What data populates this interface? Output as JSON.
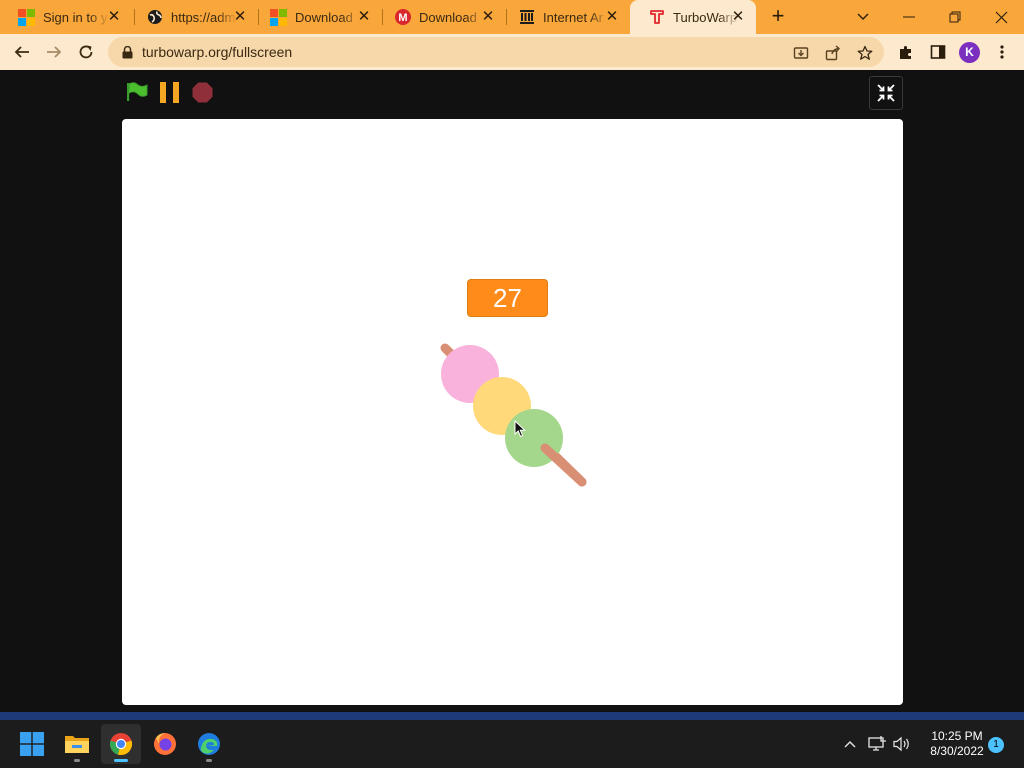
{
  "browser": {
    "tabs": [
      {
        "title": "Sign in to y",
        "icon": "microsoft-logo-icon"
      },
      {
        "title": "https://adm",
        "icon": "globe-icon"
      },
      {
        "title": "Download",
        "icon": "microsoft-logo-icon"
      },
      {
        "title": "Download",
        "icon": "mega-logo-icon"
      },
      {
        "title": "Internet Ar",
        "icon": "archive-icon"
      },
      {
        "title": "TurboWarp",
        "icon": "turbowarp-icon",
        "active": true
      }
    ],
    "close_glyph": "✕",
    "new_tab_glyph": "+",
    "url": "turbowarp.org/fullscreen",
    "profile_initial": "K",
    "accent_color": "#f9a63b",
    "toolbar_color": "#fde9cd"
  },
  "player": {
    "controls": [
      "green-flag-icon",
      "pause-icon",
      "stop-icon"
    ],
    "score": "27",
    "sprite": "dango-skewer",
    "dango_colors": [
      "#f9b2dc",
      "#ffd97a",
      "#a4d78b"
    ],
    "stick_color": "#d98f73"
  },
  "taskbar": {
    "apps": [
      "start-icon",
      "file-explorer-icon",
      "chrome-icon",
      "firefox-icon",
      "edge-icon"
    ],
    "time": "10:25 PM",
    "date": "8/30/2022",
    "notification_count": "1"
  }
}
